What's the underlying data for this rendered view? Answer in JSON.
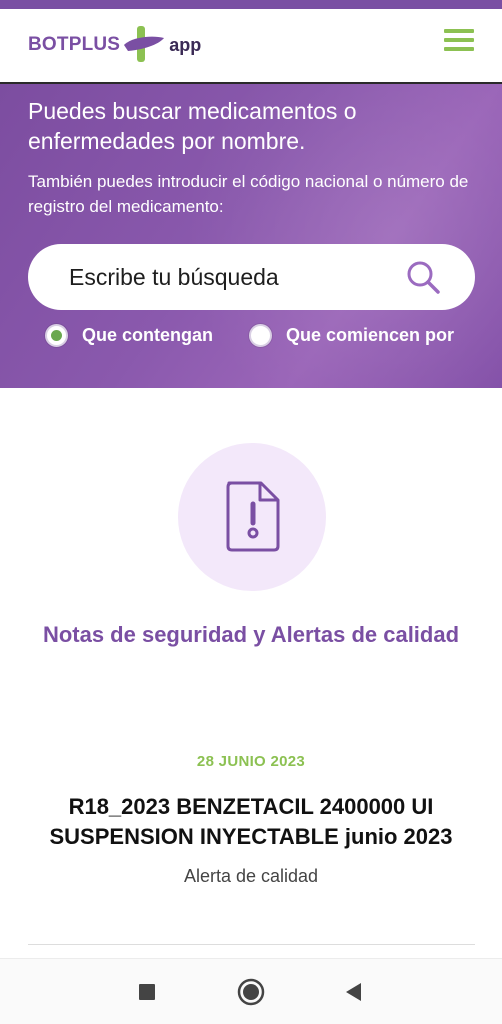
{
  "header": {
    "logo_text": "BOTPLUS",
    "logo_suffix": "app",
    "menu_icon": "hamburger-menu-icon"
  },
  "hero": {
    "title": "Puedes buscar medicamentos o enfermedades por nombre.",
    "subtitle": "También puedes introducir el código nacional o número de registro del medicamento:",
    "search": {
      "placeholder": "Escribe tu búsqueda",
      "value": "",
      "icon": "search-icon"
    },
    "options": [
      {
        "label": "Que contengan",
        "selected": true
      },
      {
        "label": "Que comiencen por",
        "selected": false
      }
    ]
  },
  "notes": {
    "icon": "document-alert-icon",
    "title": "Notas de seguridad y Alertas de calidad"
  },
  "alert": {
    "date": "28 JUNIO 2023",
    "title": "R18_2023 BENZETACIL 2400000 UI SUSPENSION INYECTABLE junio 2023",
    "type": "Alerta de calidad"
  },
  "navbar": {
    "recent_icon": "recent-apps-icon",
    "home_icon": "home-icon",
    "back_icon": "back-icon"
  },
  "colors": {
    "brand_purple": "#7a4fa3",
    "brand_green": "#8cc152",
    "notes_circle": "#f3e8fa"
  }
}
